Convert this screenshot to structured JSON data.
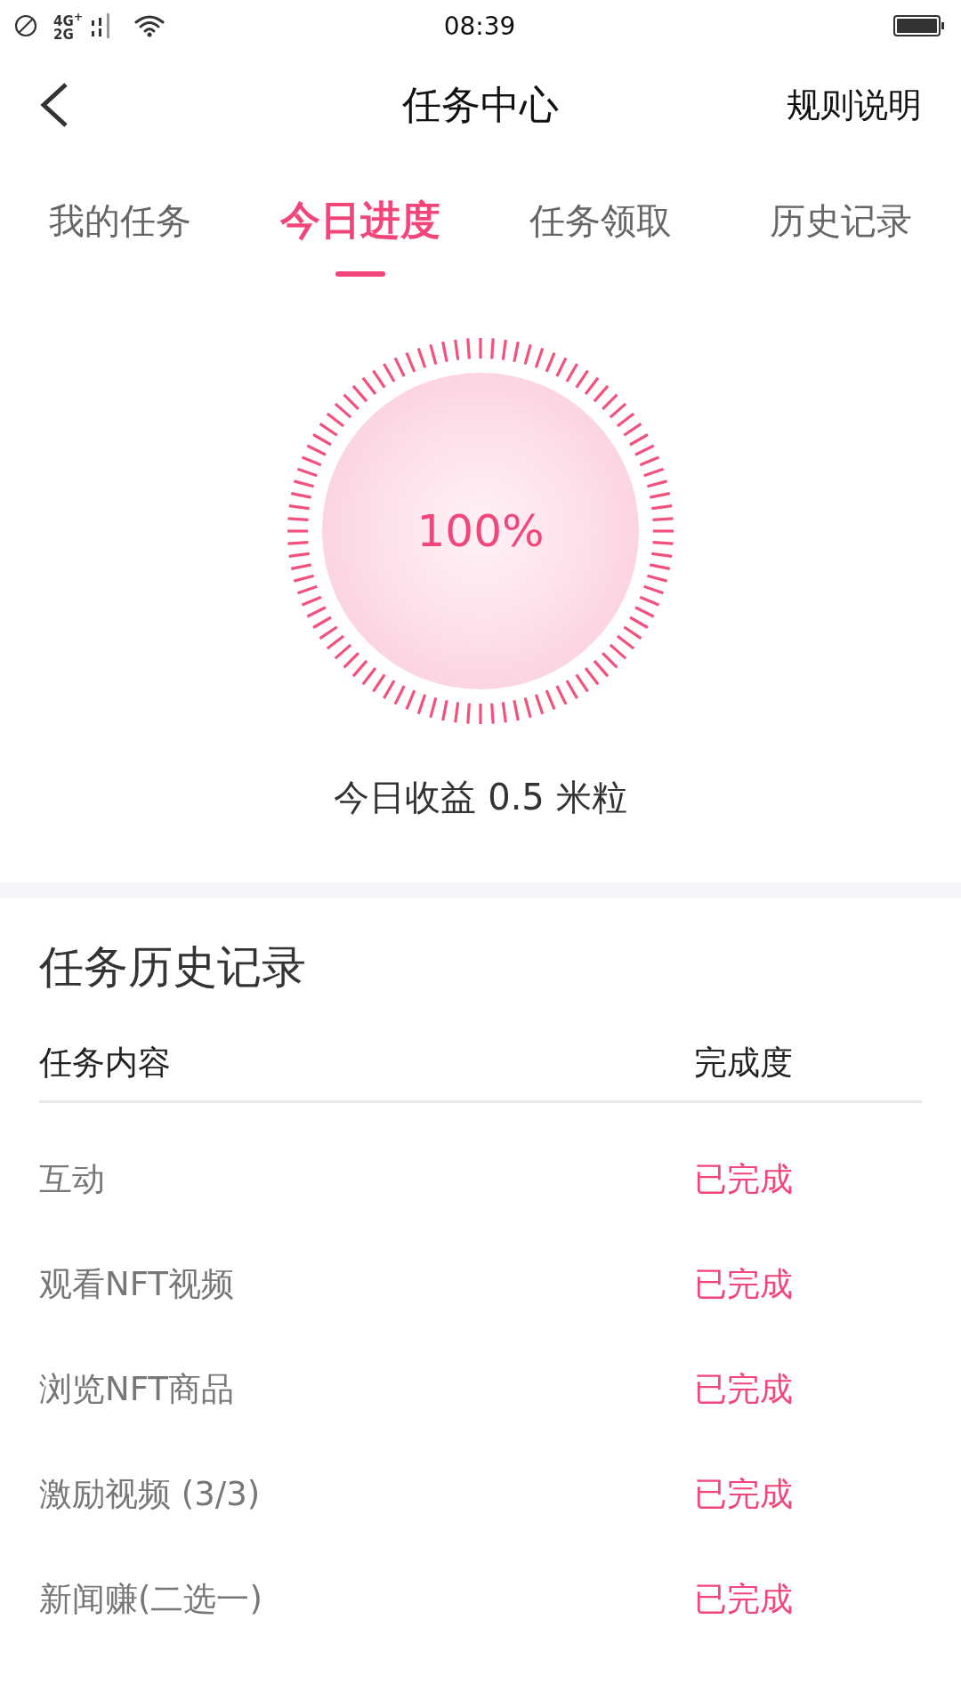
{
  "status_bar": {
    "network": [
      "4G$^{+}$",
      "2G"
    ],
    "time": "08:39"
  },
  "header": {
    "title": "任务中心",
    "action": "规则说明"
  },
  "tabs": [
    {
      "label": "我的任务",
      "selected": false
    },
    {
      "label": "今日进度",
      "selected": true
    },
    {
      "label": "任务领取",
      "selected": false
    },
    {
      "label": "历史记录",
      "selected": false
    }
  ],
  "progress": {
    "level": 1,
    "percent": "100%",
    "earnings": "今日收益 0.5 米粒"
  },
  "history": {
    "title": "任务历史记录",
    "columns": [
      "任务内容",
      "完成度"
    ],
    "rows": [
      {
        "task": "互动",
        "status": "已完成",
        "completed": true
      },
      {
        "task": "观看NFT视频",
        "status": "已完成",
        "completed": true
      },
      {
        "task": "浏览NFT商品",
        "status": "已完成",
        "completed": true
      },
      {
        "task": "激励视频 (3/3)",
        "status": "已完成",
        "completed": true
      },
      {
        "task": "新闻赚(二选一)",
        "status": "已完成",
        "completed": true
      }
    ]
  }
}
